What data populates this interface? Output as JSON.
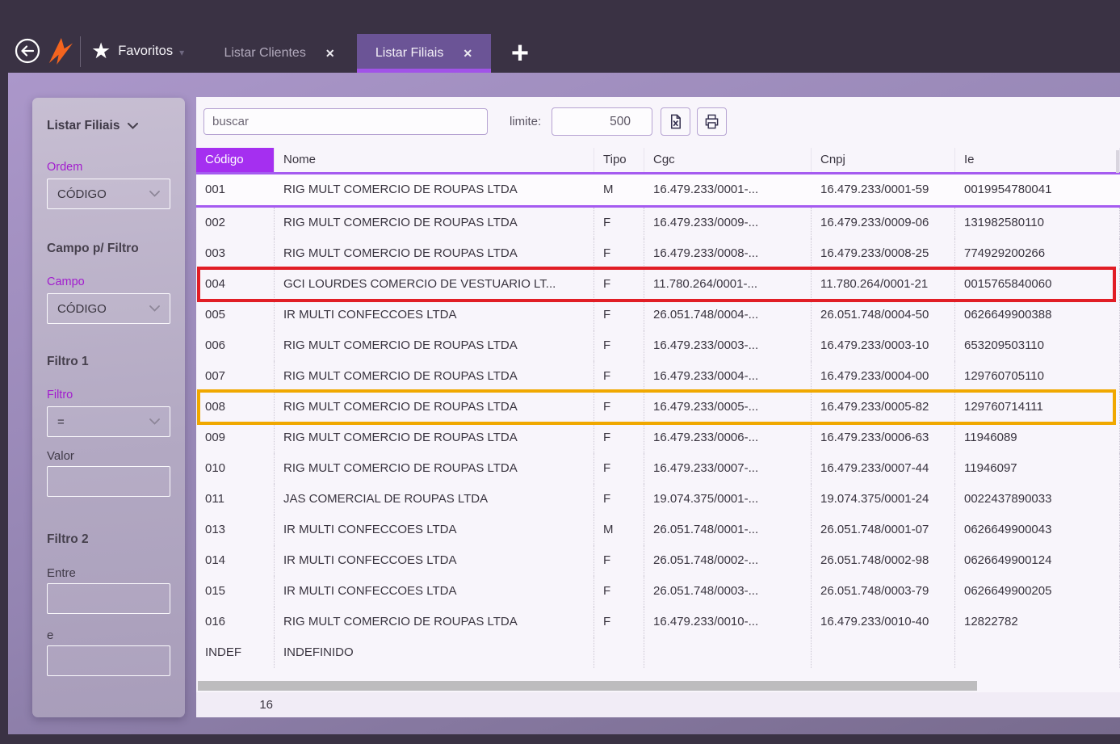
{
  "colors": {
    "topbar_bg": "#3a3244",
    "accent_purple": "#a52ff0",
    "header_underline": "#a55bf0",
    "tab_underline": "#a153e8",
    "logo_orange": "#f4641e",
    "red_annotation": "#e11d25",
    "orange_annotation": "#f0a800"
  },
  "topbar": {
    "favorites_label": "Favoritos",
    "tabs": [
      {
        "label": "Listar Clientes",
        "active": false
      },
      {
        "label": "Listar Filiais",
        "active": true
      }
    ],
    "close_glyph": "✕",
    "add_glyph": "+"
  },
  "sidebar": {
    "title": "Listar Filiais",
    "ordem_label": "Ordem",
    "ordem_value": "CÓDIGO",
    "campo_section": "Campo p/ Filtro",
    "campo_label": "Campo",
    "campo_value": "CÓDIGO",
    "filtro1_section": "Filtro 1",
    "filtro_label": "Filtro",
    "filtro_value": "=",
    "valor_label": "Valor",
    "valor_value": "",
    "filtro2_section": "Filtro 2",
    "entre_label": "Entre",
    "entre_value": "",
    "e_label": "e",
    "e_value": ""
  },
  "toolbar": {
    "search_placeholder": "buscar",
    "limit_label": "limite:",
    "limit_value": "500"
  },
  "table": {
    "columns": [
      "Código",
      "Nome",
      "Tipo",
      "Cgc",
      "Cnpj",
      "Ie"
    ],
    "selected_code": "001",
    "footer_count": "16",
    "rows": [
      {
        "code": "001",
        "name": "RIG MULT COMERCIO DE ROUPAS LTDA",
        "tipo": "M",
        "cgc": "16.479.233/0001-...",
        "cnpj": "16.479.233/0001-59",
        "ie": "0019954780041"
      },
      {
        "code": "002",
        "name": "RIG MULT COMERCIO DE ROUPAS LTDA",
        "tipo": "F",
        "cgc": "16.479.233/0009-...",
        "cnpj": "16.479.233/0009-06",
        "ie": "131982580110"
      },
      {
        "code": "003",
        "name": "RIG MULT COMERCIO DE ROUPAS LTDA",
        "tipo": "F",
        "cgc": "16.479.233/0008-...",
        "cnpj": "16.479.233/0008-25",
        "ie": "774929200266"
      },
      {
        "code": "004",
        "name": "GCI LOURDES COMERCIO DE VESTUARIO LT...",
        "tipo": "F",
        "cgc": "11.780.264/0001-...",
        "cnpj": "11.780.264/0001-21",
        "ie": "0015765840060"
      },
      {
        "code": "005",
        "name": "IR MULTI CONFECCOES LTDA",
        "tipo": "F",
        "cgc": "26.051.748/0004-...",
        "cnpj": "26.051.748/0004-50",
        "ie": "0626649900388"
      },
      {
        "code": "006",
        "name": "RIG MULT COMERCIO DE ROUPAS LTDA",
        "tipo": "F",
        "cgc": "16.479.233/0003-...",
        "cnpj": "16.479.233/0003-10",
        "ie": "653209503110"
      },
      {
        "code": "007",
        "name": "RIG MULT COMERCIO DE ROUPAS LTDA",
        "tipo": "F",
        "cgc": "16.479.233/0004-...",
        "cnpj": "16.479.233/0004-00",
        "ie": "129760705110"
      },
      {
        "code": "008",
        "name": "RIG MULT COMERCIO DE ROUPAS LTDA",
        "tipo": "F",
        "cgc": "16.479.233/0005-...",
        "cnpj": "16.479.233/0005-82",
        "ie": "129760714111"
      },
      {
        "code": "009",
        "name": "RIG MULT COMERCIO DE ROUPAS LTDA",
        "tipo": "F",
        "cgc": "16.479.233/0006-...",
        "cnpj": "16.479.233/0006-63",
        "ie": "11946089"
      },
      {
        "code": "010",
        "name": "RIG MULT COMERCIO DE ROUPAS LTDA",
        "tipo": "F",
        "cgc": "16.479.233/0007-...",
        "cnpj": "16.479.233/0007-44",
        "ie": "11946097"
      },
      {
        "code": "011",
        "name": "JAS COMERCIAL DE ROUPAS LTDA",
        "tipo": "F",
        "cgc": "19.074.375/0001-...",
        "cnpj": "19.074.375/0001-24",
        "ie": "0022437890033"
      },
      {
        "code": "013",
        "name": "IR MULTI CONFECCOES LTDA",
        "tipo": "M",
        "cgc": "26.051.748/0001-...",
        "cnpj": "26.051.748/0001-07",
        "ie": "0626649900043"
      },
      {
        "code": "014",
        "name": "IR MULTI CONFECCOES LTDA",
        "tipo": "F",
        "cgc": "26.051.748/0002-...",
        "cnpj": "26.051.748/0002-98",
        "ie": "0626649900124"
      },
      {
        "code": "015",
        "name": "IR MULTI CONFECCOES LTDA",
        "tipo": "F",
        "cgc": "26.051.748/0003-...",
        "cnpj": "26.051.748/0003-79",
        "ie": "0626649900205"
      },
      {
        "code": "016",
        "name": "RIG MULT COMERCIO DE ROUPAS LTDA",
        "tipo": "F",
        "cgc": "16.479.233/0010-...",
        "cnpj": "16.479.233/0010-40",
        "ie": "12822782"
      },
      {
        "code": "INDEF",
        "name": "INDEFINIDO",
        "tipo": "",
        "cgc": "",
        "cnpj": "",
        "ie": ""
      }
    ],
    "annotations": [
      {
        "row_code": "004",
        "color": "#e11d25",
        "name": "red-highlight-box"
      },
      {
        "row_code": "008",
        "color": "#f0a800",
        "name": "orange-highlight-box"
      }
    ]
  }
}
